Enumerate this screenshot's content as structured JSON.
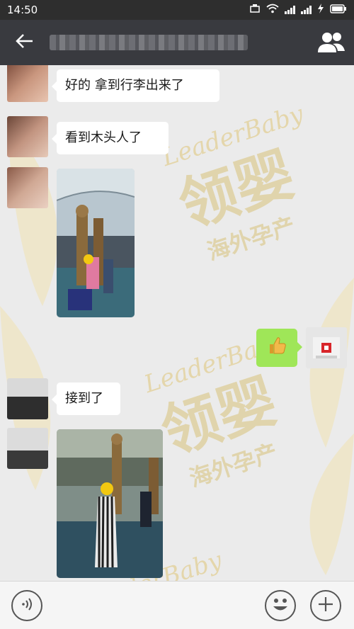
{
  "status_bar": {
    "time": "14:50",
    "battery_icon": "lightning-icon",
    "wifi_icon": "wifi-icon"
  },
  "header": {
    "title": "",
    "back_icon": "back-arrow-icon",
    "group_icon": "group-people-icon"
  },
  "watermark": {
    "brand": "LeaderBaby",
    "cn_main": "领婴",
    "cn_sub": "海外孕产",
    "color": "#e8d49a"
  },
  "messages": [
    {
      "side": "left",
      "kind": "text",
      "text": "好的 拿到行李出来了"
    },
    {
      "side": "left",
      "kind": "text",
      "text": "看到木头人了"
    },
    {
      "side": "left",
      "kind": "image"
    },
    {
      "side": "right",
      "kind": "sticker",
      "icon": "thumbs-up-icon"
    },
    {
      "side": "left",
      "kind": "text",
      "text": "接到了"
    },
    {
      "side": "left",
      "kind": "image"
    }
  ],
  "input_bar": {
    "voice_icon": "voice-icon",
    "emoji_icon": "emoji-icon",
    "plus_icon": "plus-icon"
  },
  "colors": {
    "header_bg": "#393a3f",
    "chat_bg": "#ebebeb",
    "sent_bubble": "#9fe658"
  }
}
